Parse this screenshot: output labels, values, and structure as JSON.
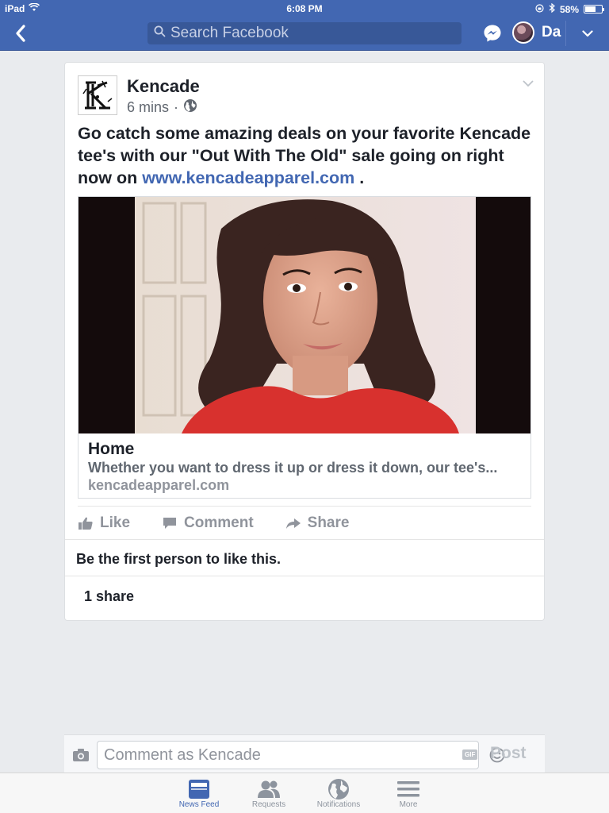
{
  "status_bar": {
    "device": "iPad",
    "time": "6:08 PM",
    "battery": "58%"
  },
  "nav": {
    "search_placeholder": "Search Facebook",
    "user_short_name": "Da"
  },
  "post": {
    "page_name": "Kencade",
    "time_ago": "6 mins",
    "separator": "·",
    "text_before_link": "Go catch some amazing deals on your favorite Kencade tee's with our \"Out With The Old\" sale going on right now on ",
    "text_link": "www.kencadeapparel.com",
    "text_after_link": " .",
    "preview": {
      "title": "Home",
      "description": "Whether you want to dress it up or dress it down, our tee's...",
      "domain": "kencadeapparel.com"
    },
    "actions": {
      "like": "Like",
      "comment": "Comment",
      "share": "Share"
    },
    "likes_text": "Be the first person to like this.",
    "shares_text": "1 share"
  },
  "comment_bar": {
    "placeholder": "Comment as Kencade",
    "gif_label": "GIF",
    "post_label": "Post"
  },
  "tabbar": {
    "tabs": [
      {
        "label": "News Feed",
        "icon": "news-feed-icon",
        "active": true
      },
      {
        "label": "Requests",
        "icon": "friend-requests-icon",
        "active": false
      },
      {
        "label": "Notifications",
        "icon": "globe-icon",
        "active": false
      },
      {
        "label": "More",
        "icon": "menu-icon",
        "active": false
      }
    ]
  },
  "colors": {
    "brand_blue": "#4267b2",
    "link_blue": "#4267b2",
    "muted_gray": "#90949c"
  }
}
